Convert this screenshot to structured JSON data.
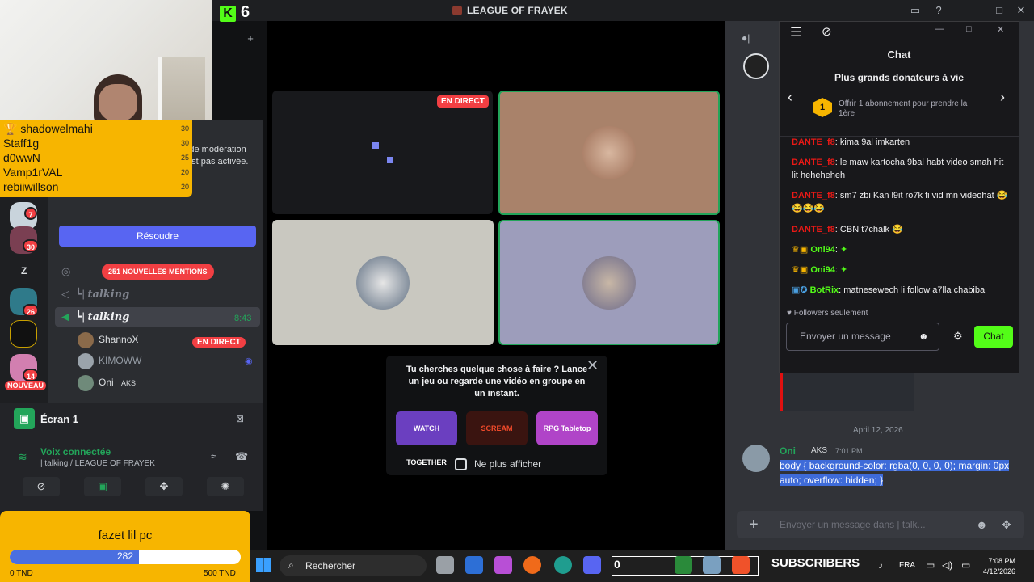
{
  "topbar": {
    "title": "LEAGUE OF FRAYEK",
    "kick_count": "6"
  },
  "donors_overlay": [
    {
      "name": "shadowelmahi",
      "value": "30"
    },
    {
      "name": "Staff1g",
      "value": "30"
    },
    {
      "name": "d0wwN",
      "value": "25"
    },
    {
      "name": "Vamp1rVAL",
      "value": "20"
    },
    {
      "name": "rebiiwillson",
      "value": "20"
    }
  ],
  "server_rail": {
    "badges": [
      "7",
      "30",
      "26",
      "14"
    ],
    "letter_server": "Z",
    "new_label": "NOUVEAU"
  },
  "channel_panel": {
    "auth_text": "isposant de ent activer cteurs. n de modération tant que cette authentification n'est pas activée.",
    "resolve_button": "Résoudre",
    "mentions_pill": "251 NOUVELLES MENTIONS",
    "channel_1": "talking",
    "channel_active": "talking",
    "active_time": "8:43",
    "voice_users": [
      {
        "name": "ShannoX",
        "badge": "EN DIRECT"
      },
      {
        "name": "KIMOWW",
        "badge": ""
      },
      {
        "name": "Oni",
        "badge": "AKS"
      }
    ]
  },
  "voice_panel": {
    "screen_label": "Écran 1",
    "connected": "Voix connectée",
    "channel": "| talking / LEAGUE OF FRAYEK"
  },
  "goal": {
    "title": "fazet lil pc",
    "current": "282",
    "fraction": 0.56,
    "min": "0 TND",
    "max": "500 TND"
  },
  "stage": {
    "live_tag": "EN DIRECT"
  },
  "activity_popup": {
    "text": "Tu cherches quelque chose à faire ? Lance un jeu ou regarde une vidéo en groupe en un instant.",
    "cards": [
      "WATCH TOGETHER",
      "SCREAM",
      "RPG Tabletop"
    ],
    "dont_show": "Ne plus afficher"
  },
  "chat_window": {
    "heading": "Chat",
    "donors_title": "Plus grands donateurs à vie",
    "rank": "1",
    "offer": "Offrir 1 abonnement pour prendre la 1ère",
    "messages": [
      {
        "user": "DANTE_f8",
        "text": ": kima 9al imkarten"
      },
      {
        "user": "DANTE_f8",
        "text": ": le maw kartocha 9bal habt video smah hit lit heheheheh"
      },
      {
        "user": "DANTE_f8",
        "text": ": sm7 zbi Kan l9it ro7k fi vid mn videohat 😂😂😂😂"
      },
      {
        "user": "DANTE_f8",
        "text": ": CBN t7chalk 😂"
      },
      {
        "user": "Oni94",
        "text": ":"
      },
      {
        "user": "Oni94",
        "text": ":"
      },
      {
        "user": "BotRix",
        "text": ": matnesewech li follow a7lla chabiba"
      }
    ],
    "followers_only": "Followers seulement",
    "input_placeholder": "Envoyer un message",
    "send": "Chat"
  },
  "message_area": {
    "date": "April 12, 2026",
    "author": "Oni",
    "author_tag": "AKS",
    "time": "7:01 PM",
    "body": "body { background-color: rgba(0, 0, 0, 0); margin: 0px auto; overflow: hidden; }",
    "composer_placeholder": "Envoyer un message dans | talk..."
  },
  "taskbar": {
    "search_placeholder": "Rechercher",
    "subscribers": "SUBSCRIBERS",
    "lang": "FRA",
    "time": "7:08 PM",
    "date": "4/12/2026",
    "sub_count": "0"
  }
}
